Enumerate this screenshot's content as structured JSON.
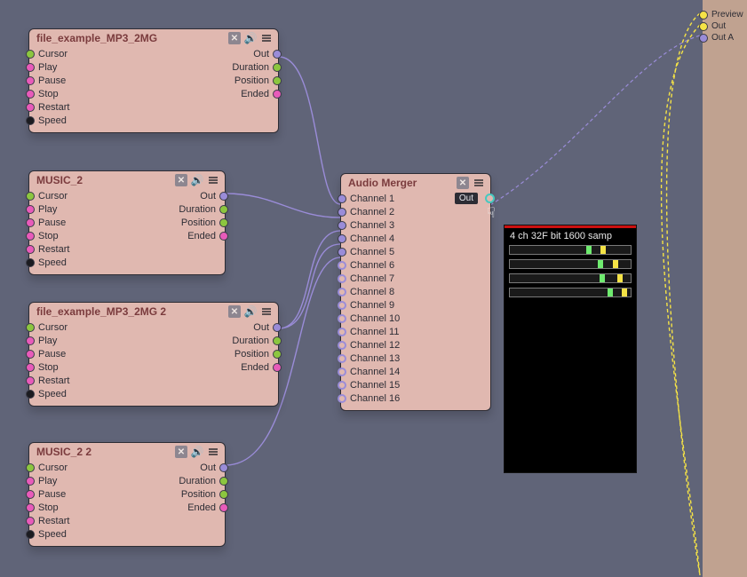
{
  "nodes": {
    "file1": {
      "title": "file_example_MP3_2MG",
      "inputs": [
        {
          "label": "Cursor",
          "color": "green"
        },
        {
          "label": "Play",
          "color": "magenta"
        },
        {
          "label": "Pause",
          "color": "magenta"
        },
        {
          "label": "Stop",
          "color": "magenta"
        },
        {
          "label": "Restart",
          "color": "magenta"
        },
        {
          "label": "Speed",
          "color": "black"
        }
      ],
      "outputs": [
        {
          "label": "Out",
          "color": "purple"
        },
        {
          "label": "Duration",
          "color": "green"
        },
        {
          "label": "Position",
          "color": "green"
        },
        {
          "label": "Ended",
          "color": "magenta"
        }
      ]
    },
    "music2": {
      "title": "MUSIC_2",
      "inputs": [
        {
          "label": "Cursor",
          "color": "green"
        },
        {
          "label": "Play",
          "color": "magenta"
        },
        {
          "label": "Pause",
          "color": "magenta"
        },
        {
          "label": "Stop",
          "color": "magenta"
        },
        {
          "label": "Restart",
          "color": "magenta"
        },
        {
          "label": "Speed",
          "color": "black"
        }
      ],
      "outputs": [
        {
          "label": "Out",
          "color": "purple"
        },
        {
          "label": "Duration",
          "color": "green"
        },
        {
          "label": "Position",
          "color": "green"
        },
        {
          "label": "Ended",
          "color": "magenta"
        }
      ]
    },
    "file2": {
      "title": "file_example_MP3_2MG 2",
      "inputs": [
        {
          "label": "Cursor",
          "color": "green"
        },
        {
          "label": "Play",
          "color": "magenta"
        },
        {
          "label": "Pause",
          "color": "magenta"
        },
        {
          "label": "Stop",
          "color": "magenta"
        },
        {
          "label": "Restart",
          "color": "magenta"
        },
        {
          "label": "Speed",
          "color": "black"
        }
      ],
      "outputs": [
        {
          "label": "Out",
          "color": "purple"
        },
        {
          "label": "Duration",
          "color": "green"
        },
        {
          "label": "Position",
          "color": "green"
        },
        {
          "label": "Ended",
          "color": "magenta"
        }
      ]
    },
    "music2b": {
      "title": "MUSIC_2 2",
      "inputs": [
        {
          "label": "Cursor",
          "color": "green"
        },
        {
          "label": "Play",
          "color": "magenta"
        },
        {
          "label": "Pause",
          "color": "magenta"
        },
        {
          "label": "Stop",
          "color": "magenta"
        },
        {
          "label": "Restart",
          "color": "magenta"
        },
        {
          "label": "Speed",
          "color": "black"
        }
      ],
      "outputs": [
        {
          "label": "Out",
          "color": "purple"
        },
        {
          "label": "Duration",
          "color": "green"
        },
        {
          "label": "Position",
          "color": "green"
        },
        {
          "label": "Ended",
          "color": "magenta"
        }
      ]
    },
    "merger": {
      "title": "Audio Merger",
      "out_label": "Out",
      "channels": [
        "Channel 1",
        "Channel 2",
        "Channel 3",
        "Channel 4",
        "Channel 5",
        "Channel 6",
        "Channel 7",
        "Channel 8",
        "Channel 9",
        "Channel 10",
        "Channel 11",
        "Channel 12",
        "Channel 13",
        "Channel 14",
        "Channel 15",
        "Channel 16"
      ]
    }
  },
  "peak": {
    "info": "4 ch  32F bit  1600 samp",
    "meters": [
      {
        "green": 63,
        "yellow": 75
      },
      {
        "green": 73,
        "yellow": 85
      },
      {
        "green": 74,
        "yellow": 89
      },
      {
        "green": 81,
        "yellow": 93
      }
    ]
  },
  "outputs": {
    "items": [
      {
        "label": "Preview",
        "color": "yellow"
      },
      {
        "label": "Out",
        "color": "yellow"
      },
      {
        "label": "Out A",
        "color": "purple"
      }
    ]
  }
}
